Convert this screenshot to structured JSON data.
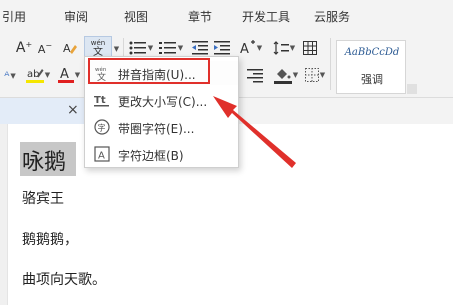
{
  "ribbon": {
    "tabs": [
      "引用",
      "审阅",
      "视图",
      "章节",
      "开发工具",
      "云服务"
    ]
  },
  "toolbar": {
    "grow_font": "A",
    "shrink_font": "A",
    "phonetic_icon_top": "wén",
    "phonetic_icon_bottom": "文",
    "style_sample": "AaBbCcDd",
    "style_name": "强调"
  },
  "menu": {
    "items": [
      {
        "label": "拼音指南(U)...",
        "icon": "phonetic-guide-icon"
      },
      {
        "label": "更改大小写(C)...",
        "icon": "change-case-icon"
      },
      {
        "label": "带圈字符(E)...",
        "icon": "enclosed-character-icon"
      },
      {
        "label": "字符边框(B)",
        "icon": "character-border-icon"
      }
    ]
  },
  "document": {
    "title": "咏鹅",
    "lines": [
      "骆宾王",
      "鹅鹅鹅，",
      "曲项向天歌。"
    ]
  },
  "colors": {
    "highlight_box": "#e0302b",
    "arrow": "#e0302b",
    "style_sample": "#2b5a93"
  }
}
